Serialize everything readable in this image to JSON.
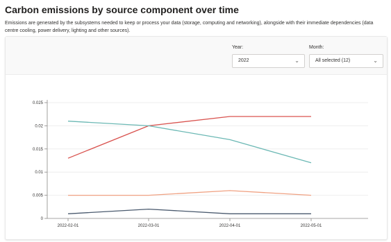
{
  "header": {
    "title": "Carbon emissions by source component over time",
    "description": "Emissions are generated by the subsystems needed to keep or process your data (storage, computing and networking), alongside with their immediate dependencies (data centre cooling, power delivery, lighting and other sources)."
  },
  "filters": {
    "year_label": "Year:",
    "year_value": "2022",
    "month_label": "Month:",
    "month_value": "All selected (12)"
  },
  "chart_data": {
    "type": "line",
    "x": [
      "2022-02-01",
      "2022-03-01",
      "2022-04-01",
      "2022-05-01"
    ],
    "ylim": [
      0,
      0.025
    ],
    "yticks": [
      "0",
      "0.005",
      "0.01",
      "0.015",
      "0.02",
      "0.025"
    ],
    "series": [
      {
        "color": "#d9534f",
        "values": [
          0.013,
          0.02,
          0.022,
          0.022
        ]
      },
      {
        "color": "#6bb8b4",
        "values": [
          0.021,
          0.02,
          0.017,
          0.012
        ]
      },
      {
        "color": "#f0a283",
        "values": [
          0.005,
          0.005,
          0.006,
          0.005
        ]
      },
      {
        "color": "#4a5a6e",
        "values": [
          0.001,
          0.002,
          0.001,
          0.001
        ]
      }
    ],
    "grid": true
  }
}
